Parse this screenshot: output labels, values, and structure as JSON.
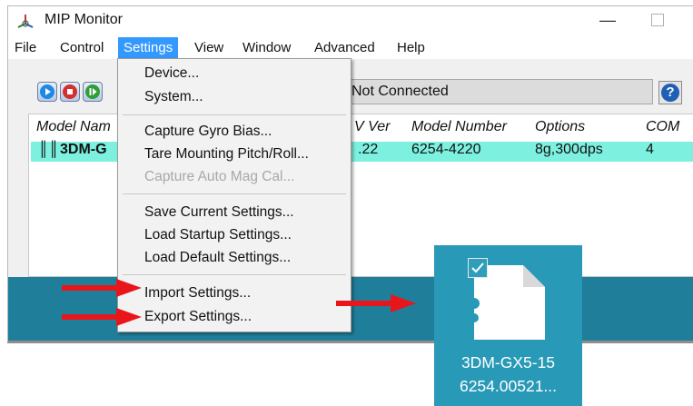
{
  "window": {
    "title": "MIP Monitor",
    "minimize_glyph": "—"
  },
  "menubar": {
    "items": [
      {
        "label": "File"
      },
      {
        "label": "Control"
      },
      {
        "label": "Settings"
      },
      {
        "label": "View"
      },
      {
        "label": "Window"
      },
      {
        "label": "Advanced"
      },
      {
        "label": "Help"
      }
    ]
  },
  "toolbar": {
    "buttons": [
      "play-icon",
      "stop-icon",
      "step-icon"
    ],
    "status": "Not Connected",
    "help_label": "?"
  },
  "device_list": {
    "columns": [
      "Model Nam",
      "V Ver",
      "Model Number",
      "Options",
      "COM"
    ],
    "rows": [
      {
        "icon": "║║",
        "model_name": "3DM-G",
        "fw_ver": ".22",
        "model_number": "6254-4220",
        "options": "8g,300dps",
        "com": "4"
      }
    ]
  },
  "settings_menu": {
    "items": [
      {
        "label": "Device..."
      },
      {
        "label": "System..."
      },
      {
        "label": "Capture Gyro Bias..."
      },
      {
        "label": "Tare Mounting Pitch/Roll..."
      },
      {
        "label": "Capture Auto Mag Cal...",
        "disabled": true
      },
      {
        "label": "Save Current Settings..."
      },
      {
        "label": "Load Startup Settings..."
      },
      {
        "label": "Load Default Settings..."
      },
      {
        "label": "Import Settings..."
      },
      {
        "label": "Export Settings..."
      }
    ]
  },
  "desktop_file": {
    "name_line1": "3DM-GX5-15",
    "name_line2": "6254.00521..."
  },
  "colors": {
    "menu_highlight": "#3399ff",
    "row_highlight": "#7df0df",
    "annotation_arrow": "#e8161b",
    "desktop_tile": "#2899b6"
  }
}
